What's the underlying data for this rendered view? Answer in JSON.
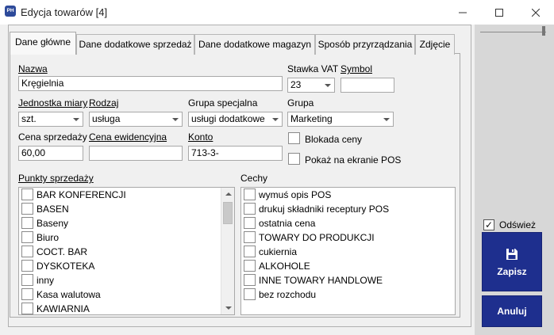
{
  "window": {
    "app_icon_text": "PH",
    "title": "Edycja towarów [4]"
  },
  "tabs": [
    {
      "label": "Dane główne",
      "active": true
    },
    {
      "label": "Dane dodatkowe sprzedaż",
      "active": false
    },
    {
      "label": "Dane dodatkowe magazyn",
      "active": false
    },
    {
      "label": "Sposób przyrządzania",
      "active": false
    },
    {
      "label": "Zdjęcie",
      "active": false
    }
  ],
  "form": {
    "nazwa_label": "Nazwa",
    "nazwa_value": "Kręgielnia",
    "stawka_vat_label": "Stawka VAT",
    "stawka_vat_value": "23",
    "symbol_label": "Symbol",
    "symbol_value": "",
    "jednostka_label": "Jednostka miary",
    "jednostka_value": "szt.",
    "rodzaj_label": "Rodzaj",
    "rodzaj_value": "usługa",
    "grupa_specjalna_label": "Grupa specjalna",
    "grupa_specjalna_value": "usługi dodatkowe",
    "grupa_label": "Grupa",
    "grupa_value": "Marketing",
    "cena_sprzedazy_label": "Cena sprzedaży",
    "cena_sprzedazy_value": "60,00",
    "cena_ewidencyjna_label": "Cena ewidencyjna",
    "cena_ewidencyjna_value": "",
    "konto_label": "Konto",
    "konto_value": "713-3-",
    "blokada_ceny_label": "Blokada ceny",
    "pokaz_pos_label": "Pokaż na ekranie POS"
  },
  "punkty_sprzedazy": {
    "label": "Punkty sprzedaży",
    "items": [
      "BAR KONFERENCJI",
      "BASEN",
      "Baseny",
      "Biuro",
      "COCT. BAR",
      "DYSKOTEKA",
      "inny",
      "Kasa walutowa",
      "KAWIARNIA"
    ]
  },
  "cechy": {
    "label": "Cechy",
    "items": [
      "wymuś opis POS",
      "drukuj składniki receptury POS",
      "ostatnia cena",
      "TOWARY DO PRODUKCJI",
      "cukiernia",
      "ALKOHOLE",
      "INNE TOWARY HANDLOWE",
      "bez rozchodu"
    ]
  },
  "sidebar": {
    "refresh_label": "Odśwież",
    "refresh_checked": "✓",
    "save_label": "Zapisz",
    "cancel_label": "Anuluj"
  },
  "colors": {
    "button_bg": "#1e2f8e",
    "app_icon_bg": "#2d4a9a"
  }
}
